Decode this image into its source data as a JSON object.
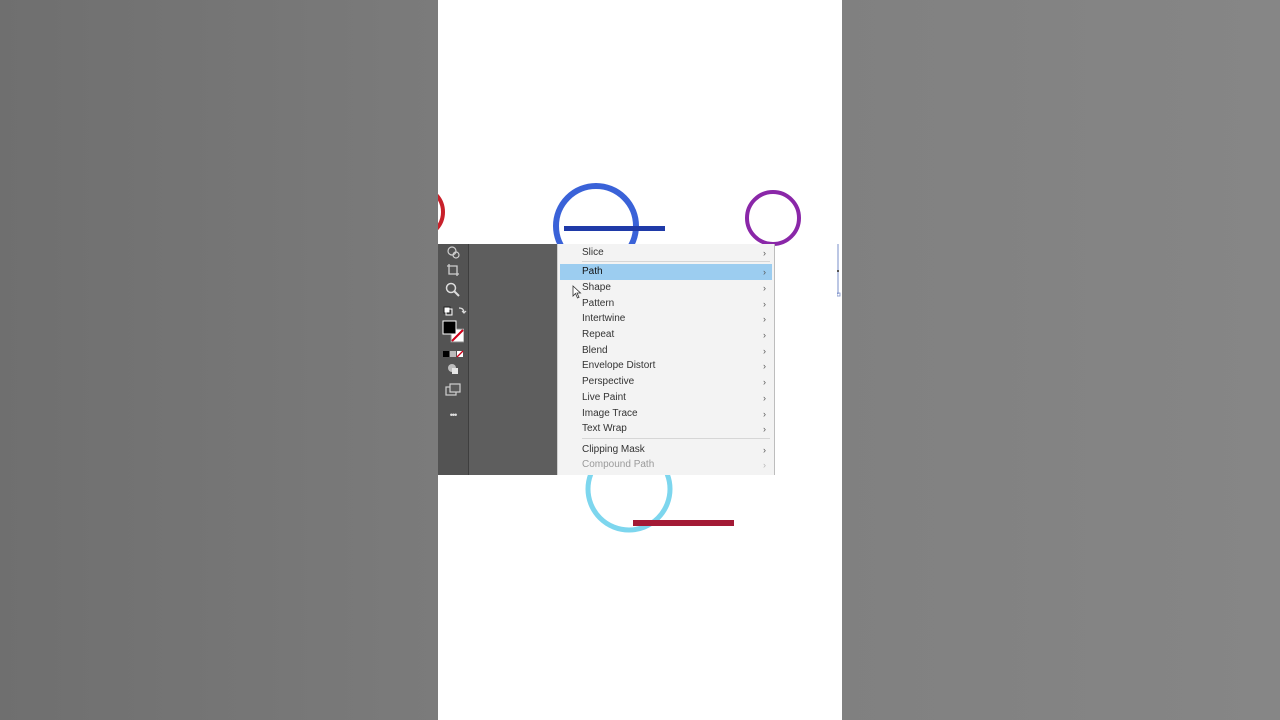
{
  "context_menu": {
    "items": [
      {
        "label": "Slice",
        "state": "normal"
      },
      {
        "label": "Path",
        "state": "highlighted"
      },
      {
        "label": "Shape",
        "state": "normal"
      },
      {
        "label": "Pattern",
        "state": "normal"
      },
      {
        "label": "Intertwine",
        "state": "normal"
      },
      {
        "label": "Repeat",
        "state": "normal"
      },
      {
        "label": "Blend",
        "state": "normal"
      },
      {
        "label": "Envelope Distort",
        "state": "normal"
      },
      {
        "label": "Perspective",
        "state": "normal"
      },
      {
        "label": "Live Paint",
        "state": "normal"
      },
      {
        "label": "Image Trace",
        "state": "normal"
      },
      {
        "label": "Text Wrap",
        "state": "normal"
      },
      {
        "label": "Clipping Mask",
        "state": "normal"
      },
      {
        "label": "Compound Path",
        "state": "disabled"
      }
    ],
    "submenu_glyph": "›",
    "highlight_color": "#9ccdf0"
  },
  "toolbar": {
    "tools": [
      "shape-builder-icon",
      "artboard-icon",
      "zoom-icon",
      "swap-colors-icon",
      "fill-stroke-icon",
      "color-modes-icon",
      "draw-modes-icon",
      "screen-mode-icon",
      "more-tools-icon"
    ],
    "more_glyph": "•••"
  },
  "artwork": {
    "colors": {
      "red_circle": "#c8202a",
      "blue_circle": "#3a62d8",
      "blue_bar": "#1f3aa8",
      "purple_circle": "#8a27a8",
      "cyan_circle": "#7dd6ee",
      "red_bar": "#a31a35"
    }
  }
}
